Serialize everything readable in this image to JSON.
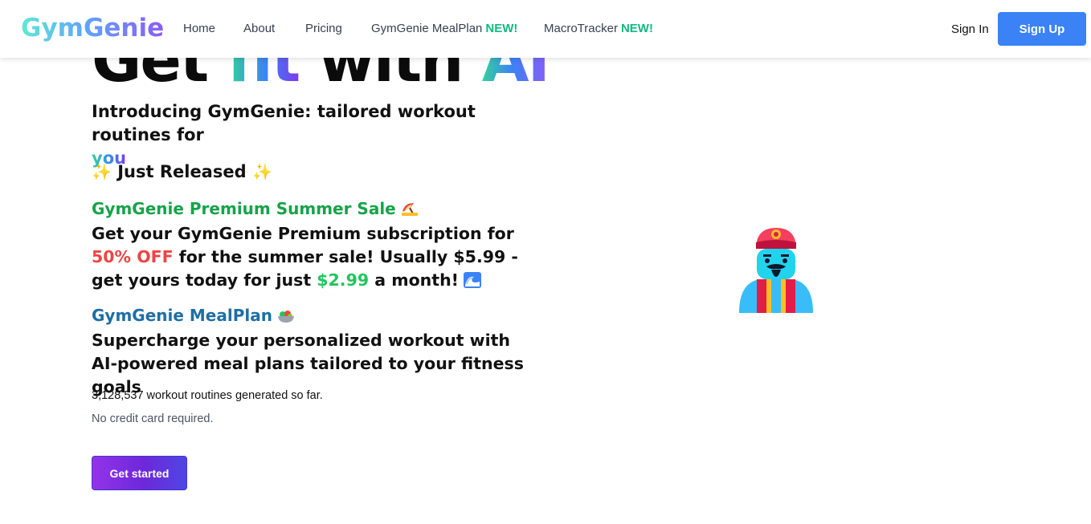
{
  "nav": {
    "logo": "GymGenie",
    "links": [
      {
        "label": "Home",
        "badge": ""
      },
      {
        "label": "About",
        "badge": ""
      },
      {
        "label": "Pricing",
        "badge": ""
      },
      {
        "label": "GymGenie MealPlan",
        "badge": "NEW!"
      },
      {
        "label": "MacroTracker",
        "badge": "NEW!"
      }
    ],
    "signin": "Sign In",
    "signup": "Sign Up"
  },
  "hero": {
    "title_part1": "Get ",
    "title_part2": "fit",
    "title_part3": " with ",
    "title_part4": "AI",
    "intro_text": "Introducing GymGenie: tailored workout routines for",
    "intro_highlight": "you",
    "released": "Just Released",
    "sale": {
      "title": "GymGenie Premium Summer Sale",
      "body_1": "Get your GymGenie Premium subscription for ",
      "discount": "50% OFF",
      "body_2": " for the summer sale! Usually $5.99 - get yours today for just ",
      "price": "$2.99",
      "body_3": " a month!"
    },
    "mealplan": {
      "title": "GymGenie MealPlan",
      "body": "Supercharge your personalized workout with AI-powered meal plans tailored to your fitness goals"
    },
    "stats": "3,128,537 workout routines generated so far.",
    "no_card": "No credit card required.",
    "cta": "Get started"
  },
  "icons": {
    "sparkle": "sparkles-icon",
    "sale": "beach-umbrella-icon",
    "wave": "wave-icon",
    "salad": "salad-bowl-icon",
    "genie": "genie-icon"
  }
}
